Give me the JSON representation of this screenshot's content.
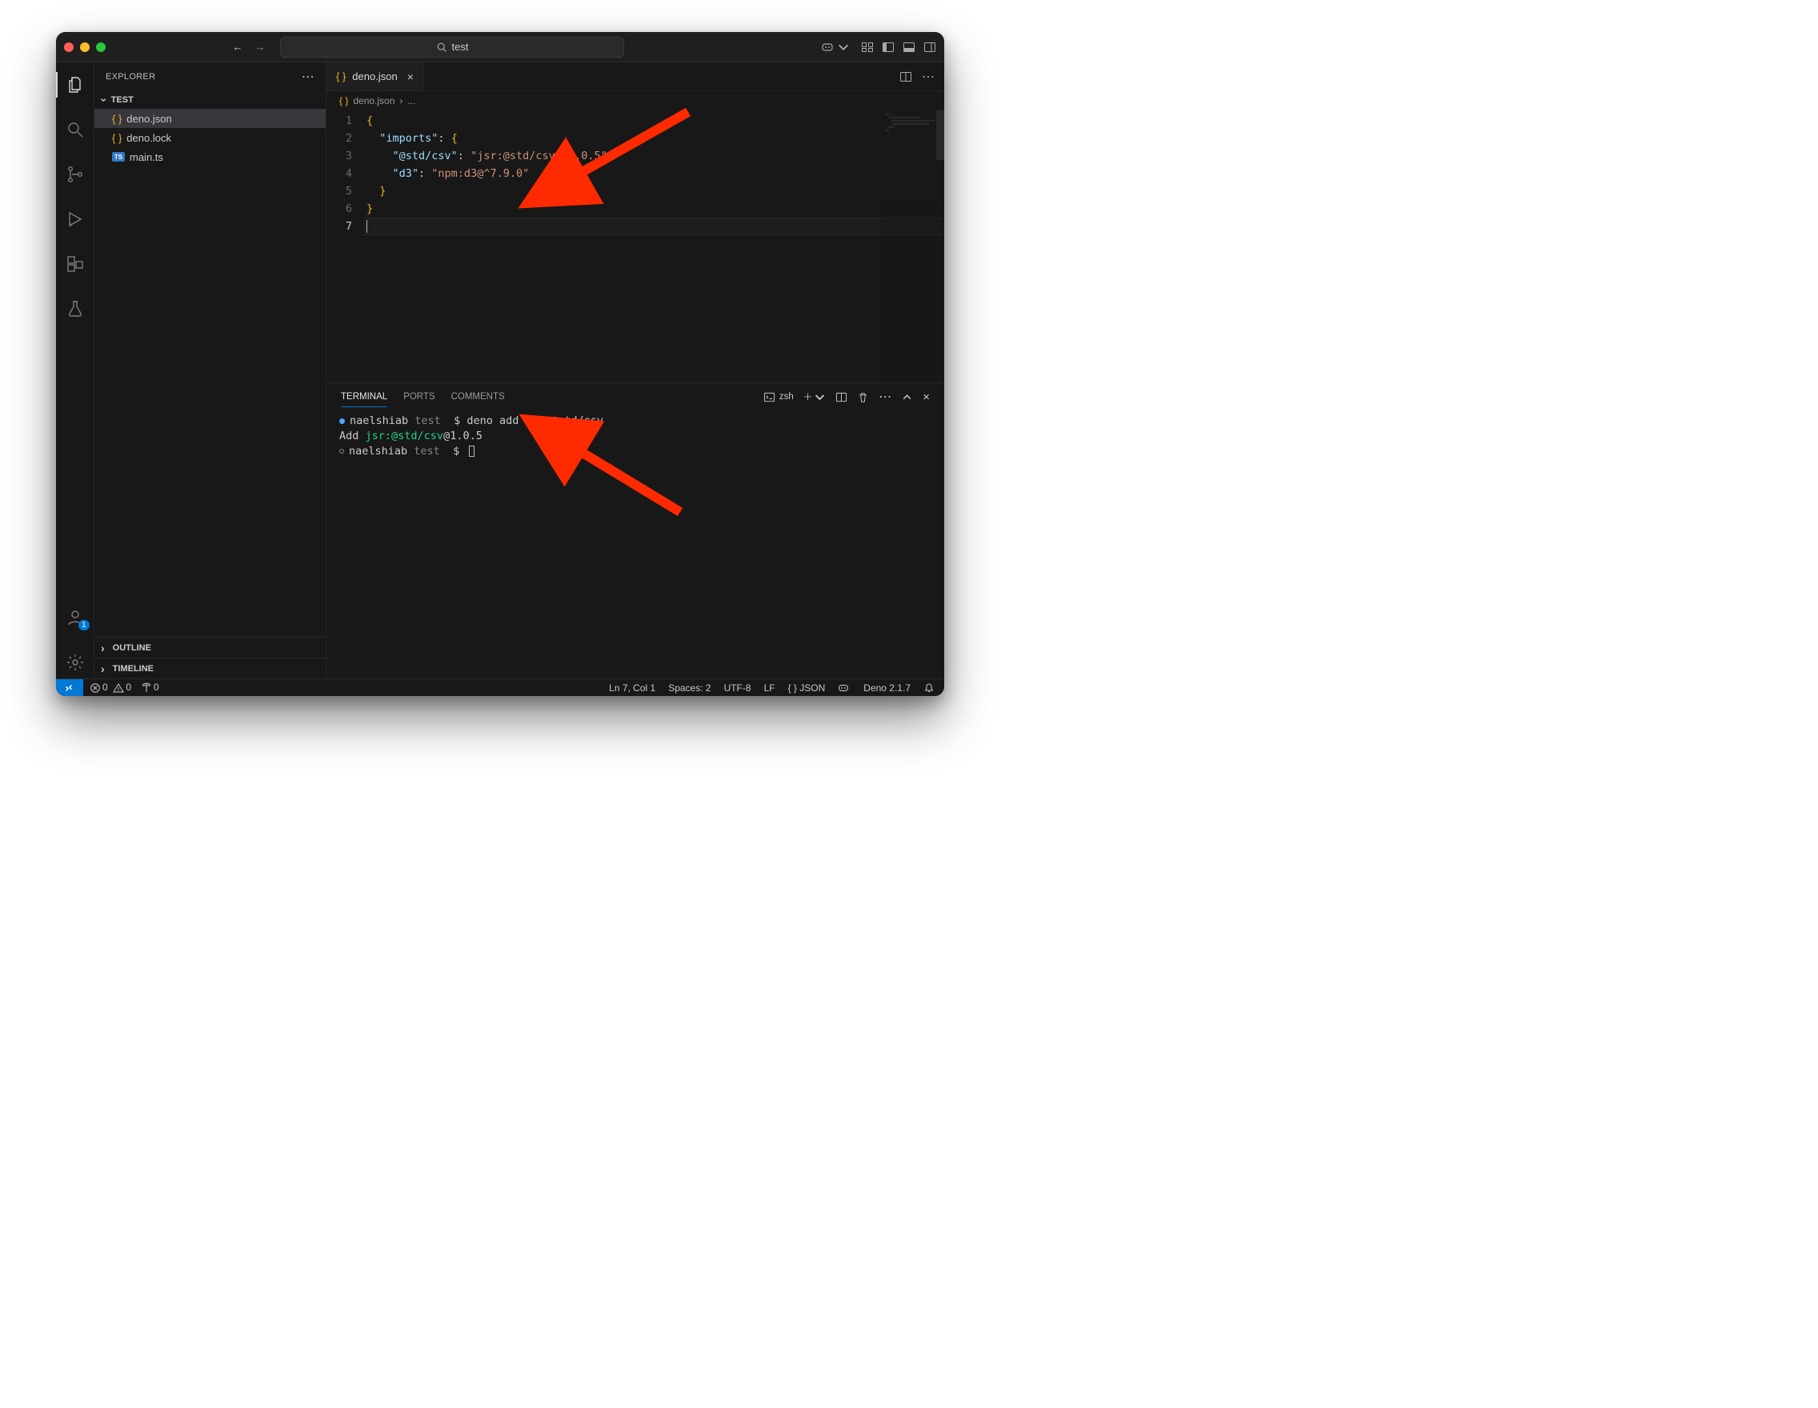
{
  "titlebar": {
    "search_text": "test"
  },
  "sidebar": {
    "title": "EXPLORER",
    "project": "TEST",
    "files": [
      {
        "name": "deno.json",
        "icon": "json",
        "selected": true
      },
      {
        "name": "deno.lock",
        "icon": "json",
        "selected": false
      },
      {
        "name": "main.ts",
        "icon": "ts",
        "selected": false
      }
    ],
    "outline_label": "OUTLINE",
    "timeline_label": "TIMELINE"
  },
  "activity": {
    "account_badge": "1"
  },
  "tabs": {
    "active": "deno.json"
  },
  "breadcrumb": {
    "file": "deno.json",
    "suffix": "..."
  },
  "editor": {
    "code": {
      "line2_key": "\"imports\"",
      "line3_key": "\"@std/csv\"",
      "line3_val": "\"jsr:@std/csv@^1.0.5\"",
      "line4_key": "\"d3\"",
      "line4_val": "\"npm:d3@^7.9.0\""
    },
    "line_numbers": [
      "1",
      "2",
      "3",
      "4",
      "5",
      "6",
      "7"
    ]
  },
  "panel": {
    "tabs": {
      "terminal": "TERMINAL",
      "ports": "PORTS",
      "comments": "COMMENTS"
    },
    "shell_label": "zsh",
    "term": {
      "user": "naelshiab",
      "dir": "test",
      "prompt": "$",
      "cmd1": "deno add jsr:@std/csv",
      "out_prefix": "Add ",
      "out_green": "jsr:@std/csv",
      "out_rest": "@1.0.5"
    }
  },
  "status": {
    "errors": "0",
    "warnings": "0",
    "ports": "0",
    "position": "Ln 7, Col 1",
    "spaces": "Spaces: 2",
    "encoding": "UTF-8",
    "eol": "LF",
    "language": "JSON",
    "deno": "Deno 2.1.7"
  }
}
